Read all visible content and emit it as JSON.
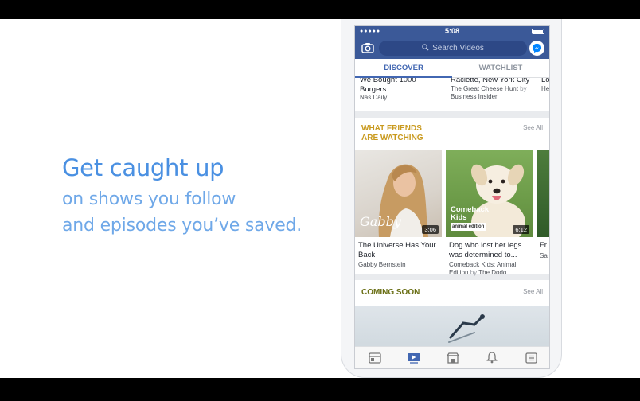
{
  "promo": {
    "headline": "Get caught up",
    "line1": "on shows you follow",
    "line2": "and episodes you’ve saved."
  },
  "status_bar": {
    "time": "5:08"
  },
  "search": {
    "placeholder": "Search Videos"
  },
  "tabs": [
    {
      "label": "DISCOVER",
      "active": true
    },
    {
      "label": "WATCHLIST",
      "active": false
    }
  ],
  "top_cards": [
    {
      "title_line1": "We Bought 1000",
      "title_line2": "Burgers",
      "meta": "Nas Daily",
      "by": ""
    },
    {
      "title_line1": "Raclette, New York City",
      "meta1": "The Great Cheese Hunt",
      "by": "by",
      "meta2": "Business Insider"
    },
    {
      "title_line1": "Lo",
      "meta": "He"
    }
  ],
  "friends_section": {
    "title_line1": "WHAT FRIENDS",
    "title_line2": "ARE WATCHING",
    "see_all": "See All",
    "videos": [
      {
        "title_line1": "The Universe Has Your",
        "title_line2": "Back",
        "meta": "Gabby Bernstein",
        "duration": "3:06",
        "overlay": "Gabby"
      },
      {
        "title_line1": "Dog who lost her legs",
        "title_line2": "was determined to...",
        "meta_line1": "Comeback Kids: Animal",
        "meta_line2_a": "Edition",
        "by": "by",
        "meta_line2_b": "The Dodo",
        "duration": "6:12",
        "overlay_a": "Comeback",
        "overlay_b": "Kids",
        "overlay_c": "animal edition"
      },
      {
        "title_line1": "Fr",
        "meta": "Sa"
      }
    ]
  },
  "coming_soon": {
    "title": "COMING SOON",
    "see_all": "See All"
  },
  "bottom_nav": [
    "news-feed-icon",
    "video-icon",
    "marketplace-icon",
    "notifications-icon",
    "menu-icon"
  ],
  "colors": {
    "brand": "#3b5998",
    "accent": "#4267b2",
    "gold": "#c99a1f",
    "olive": "#6a6f15",
    "promo": "#4a90e2"
  }
}
